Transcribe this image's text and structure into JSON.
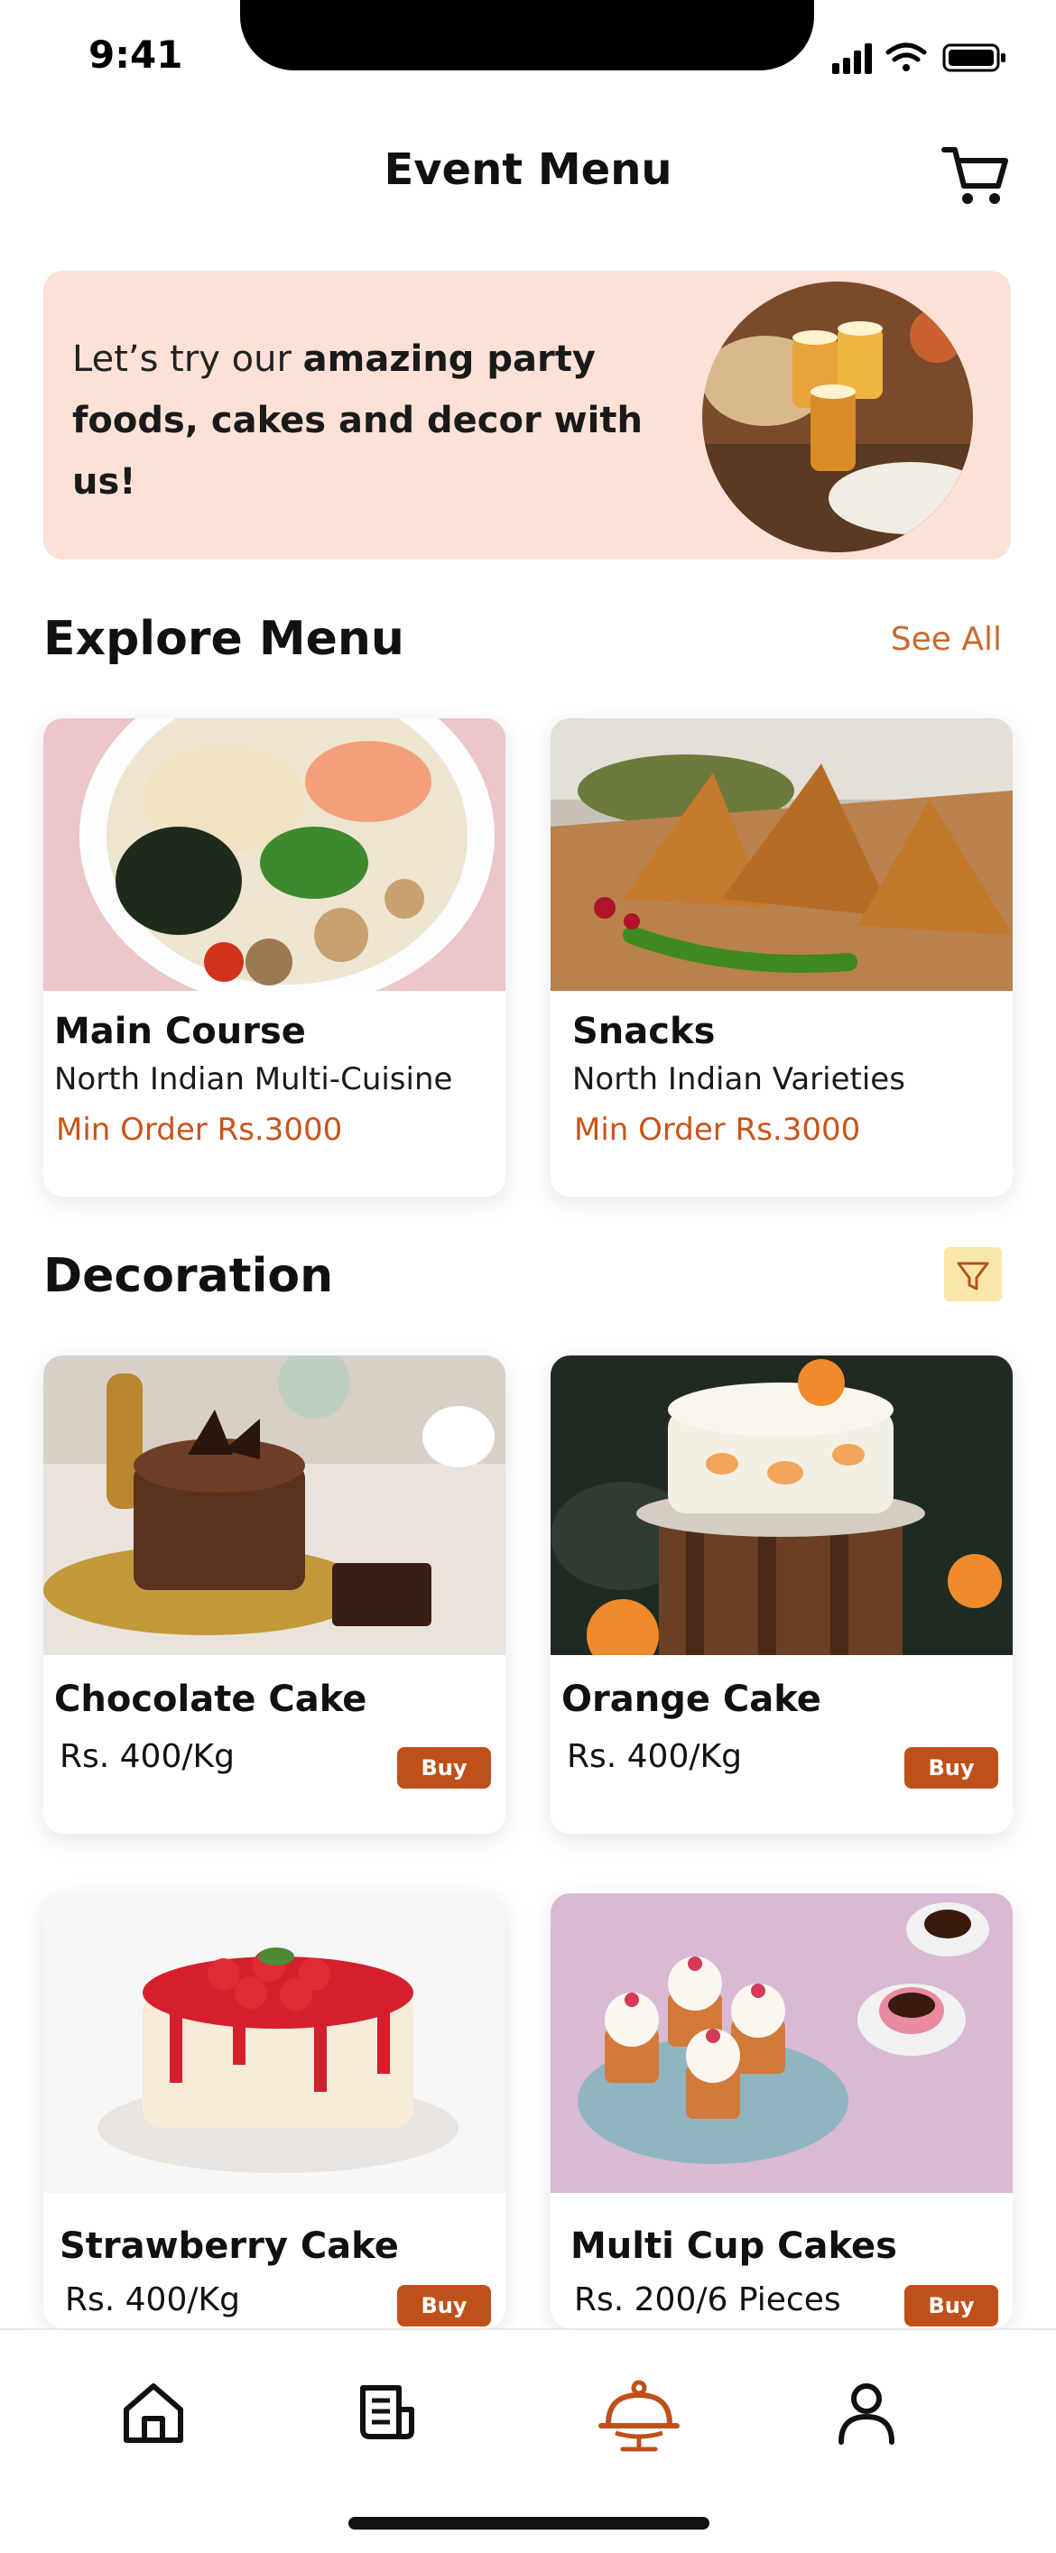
{
  "status": {
    "time": "9:41"
  },
  "header": {
    "title": "Event Menu"
  },
  "banner": {
    "text_plain": "Let’s try our ",
    "text_bold_1": "amazing party",
    "text_bold_2": "foods, cakes and decor with us!"
  },
  "explore": {
    "title": "Explore Menu",
    "see_all": "See All",
    "items": [
      {
        "title": "Main Course",
        "subtitle": "North Indian Multi-Cuisine",
        "min_order": "Min Order Rs.3000"
      },
      {
        "title": "Snacks",
        "subtitle": "North Indian Varieties",
        "min_order": "Min Order Rs.3000"
      }
    ]
  },
  "decoration": {
    "title": "Decoration",
    "items": [
      {
        "title": "Chocolate Cake",
        "price": "Rs. 400/Kg",
        "buy": "Buy"
      },
      {
        "title": "Orange Cake",
        "price": "Rs. 400/Kg",
        "buy": "Buy"
      },
      {
        "title": "Strawberry Cake",
        "price": "Rs. 400/Kg",
        "buy": "Buy"
      },
      {
        "title": "Multi Cup Cakes",
        "price": "Rs. 200/6 Pieces",
        "buy": "Buy"
      }
    ]
  },
  "nav": {
    "items": [
      {
        "icon": "home-icon",
        "active": false
      },
      {
        "icon": "orders-icon",
        "active": false
      },
      {
        "icon": "food-cloche-icon",
        "active": true
      },
      {
        "icon": "profile-icon",
        "active": false
      }
    ]
  },
  "colors": {
    "accent": "#c0501a",
    "banner_bg": "#fde1d6",
    "filter_bg": "#fbe6a9",
    "link": "#c96a2c"
  }
}
